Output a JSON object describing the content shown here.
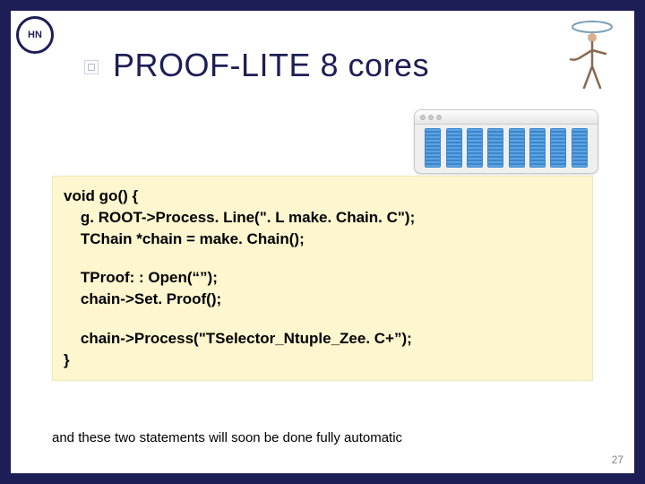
{
  "logo_left_text": "HN",
  "title": "PROOF-LITE 8 cores",
  "cpu_bars": 8,
  "code": {
    "l1": "void go() {",
    "l2": "    g. ROOT->Process. Line(\". L make. Chain. C\");",
    "l3": "    TChain *chain = make. Chain();",
    "l4": "    TProof: : Open(“”);",
    "l5": "    chain->Set. Proof();",
    "l6": "    chain->Process(\"TSelector_Ntuple_Zee. C+”);",
    "l7": "}"
  },
  "footnote": "and these two statements will soon be done fully automatic",
  "page_number": "27"
}
